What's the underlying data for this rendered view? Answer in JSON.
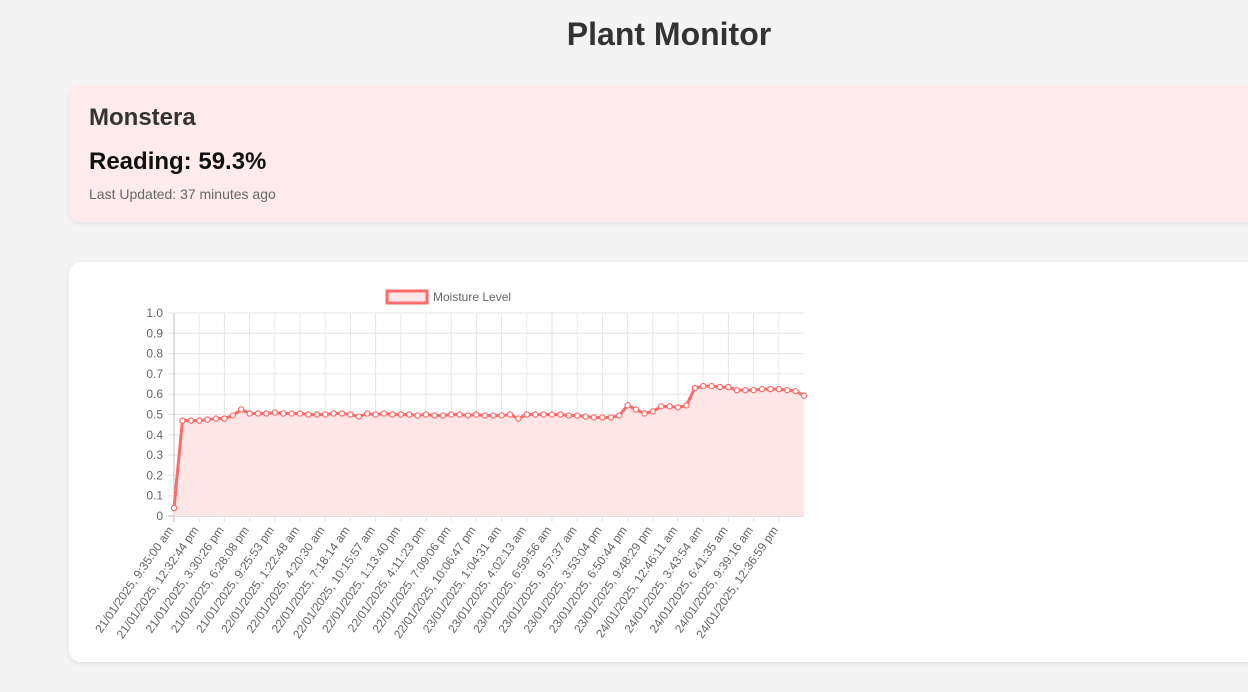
{
  "page": {
    "title": "Plant Monitor"
  },
  "plant": {
    "name": "Monstera",
    "reading_label": "Reading:",
    "reading_value": "59.3%",
    "last_updated_label": "Last Updated:",
    "last_updated_value": "37 minutes ago"
  },
  "colors": {
    "series": "#ff6b6b",
    "fill": "#ffe6e6",
    "card": "#ffebeb",
    "background": "#f4f4f4"
  },
  "chart_data": {
    "type": "line",
    "legend": {
      "position": "top",
      "entries": [
        "Moisture Level"
      ]
    },
    "ylim": [
      0,
      1.0
    ],
    "yticks": [
      "0",
      "0.1",
      "0.2",
      "0.3",
      "0.4",
      "0.5",
      "0.6",
      "0.7",
      "0.8",
      "0.9",
      "1.0"
    ],
    "grid": true,
    "x_tick_labels": [
      "21/01/2025, 9:35:00 am",
      "21/01/2025, 12:32:44 pm",
      "21/01/2025, 3:30:26 pm",
      "21/01/2025, 6:28:08 pm",
      "21/01/2025, 9:25:53 pm",
      "22/01/2025, 1:22:48 am",
      "22/01/2025, 4:20:30 am",
      "22/01/2025, 7:18:14 am",
      "22/01/2025, 10:15:57 am",
      "22/01/2025, 1:13:40 pm",
      "22/01/2025, 4:11:23 pm",
      "22/01/2025, 7:09:06 pm",
      "22/01/2025, 10:06:47 pm",
      "23/01/2025, 1:04:31 am",
      "23/01/2025, 4:02:13 am",
      "23/01/2025, 6:59:56 am",
      "23/01/2025, 9:57:37 am",
      "23/01/2025, 3:53:04 pm",
      "23/01/2025, 6:50:44 pm",
      "23/01/2025, 9:48:29 pm",
      "24/01/2025, 12:46:11 am",
      "24/01/2025, 3:43:54 am",
      "24/01/2025, 6:41:35 am",
      "24/01/2025, 9:39:16 am",
      "24/01/2025, 12:36:59 pm"
    ],
    "series": [
      {
        "name": "Moisture Level",
        "values": [
          0.04,
          0.47,
          0.47,
          0.47,
          0.475,
          0.48,
          0.48,
          0.495,
          0.525,
          0.505,
          0.505,
          0.505,
          0.51,
          0.505,
          0.505,
          0.505,
          0.5,
          0.5,
          0.5,
          0.505,
          0.505,
          0.5,
          0.49,
          0.505,
          0.5,
          0.505,
          0.5,
          0.5,
          0.5,
          0.495,
          0.5,
          0.495,
          0.495,
          0.5,
          0.5,
          0.495,
          0.5,
          0.495,
          0.495,
          0.495,
          0.5,
          0.48,
          0.5,
          0.5,
          0.5,
          0.5,
          0.5,
          0.495,
          0.495,
          0.49,
          0.485,
          0.485,
          0.485,
          0.495,
          0.545,
          0.525,
          0.505,
          0.515,
          0.54,
          0.54,
          0.535,
          0.545,
          0.63,
          0.64,
          0.64,
          0.635,
          0.635,
          0.62,
          0.62,
          0.62,
          0.625,
          0.625,
          0.625,
          0.62,
          0.615,
          0.593
        ]
      }
    ]
  }
}
